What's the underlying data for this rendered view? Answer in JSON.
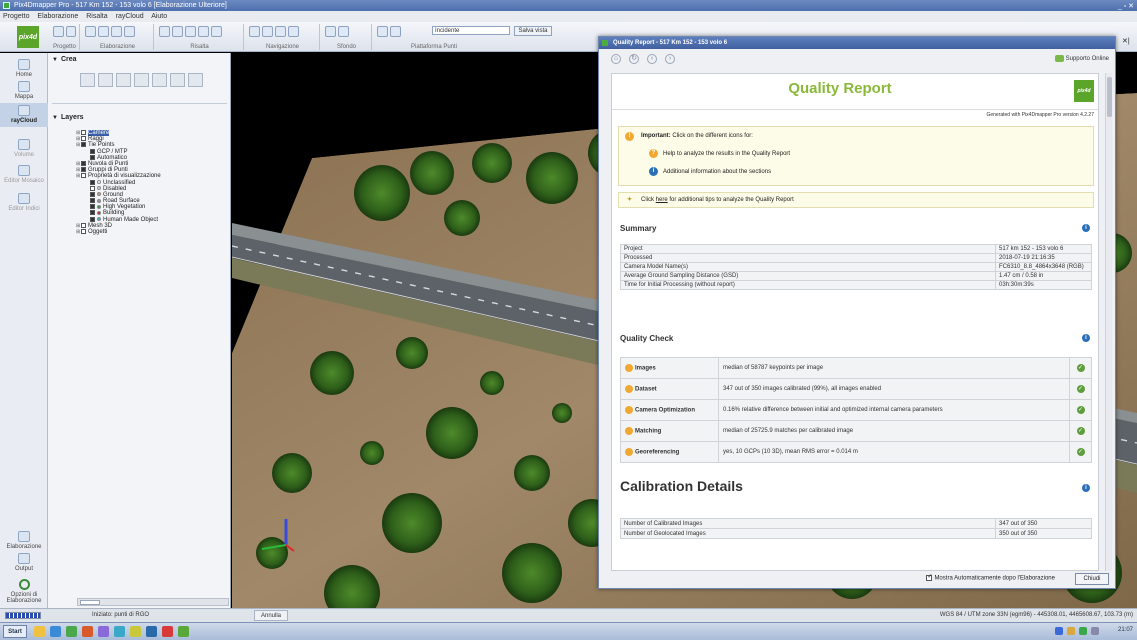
{
  "app": {
    "title": "Pix4Dmapper Pro - 517 Km 152 - 153 volo 6 [Elaborazione Ulteriore]",
    "menu": [
      "Progetto",
      "Elaborazione",
      "Risalta",
      "rayCloud",
      "Aiuto"
    ]
  },
  "ribbon": {
    "logo_text": "pix4d",
    "groups": [
      "Progetto",
      "Elaborazione",
      "Risalta",
      "Navigazione",
      "Sfondo",
      "Piattaforma Punti"
    ],
    "combo_value": "Incidente",
    "button_label": "Salva vista"
  },
  "leftnav": {
    "items": [
      {
        "label": "Home",
        "active": false
      },
      {
        "label": "Mappa",
        "active": false
      },
      {
        "label": "rayCloud",
        "active": true
      },
      {
        "label": "Volume",
        "active": false
      },
      {
        "label": "Editor Mosaico",
        "active": false
      },
      {
        "label": "Editor Indici",
        "active": false
      }
    ],
    "bottom_items": [
      {
        "label": "Elaborazione"
      },
      {
        "label": "Output"
      },
      {
        "label": "Opzioni di Elaborazione"
      }
    ]
  },
  "sidepanel": {
    "crop_title": "Crea",
    "layers_title": "Layers",
    "tree": [
      {
        "label": "Camere",
        "level": 0,
        "checked": false,
        "selected": true,
        "dot": null
      },
      {
        "label": "Raggi",
        "level": 0,
        "checked": false,
        "selected": false,
        "dot": null
      },
      {
        "label": "Tie Points",
        "level": 0,
        "checked": true,
        "selected": false,
        "dot": null
      },
      {
        "label": "GCP / MTP",
        "level": 1,
        "checked": true,
        "selected": false,
        "dot": null
      },
      {
        "label": "Automatico",
        "level": 1,
        "checked": true,
        "selected": false,
        "dot": null
      },
      {
        "label": "Nuvola di Punti",
        "level": 0,
        "checked": true,
        "selected": false,
        "dot": null
      },
      {
        "label": "Gruppi di Punti",
        "level": 0,
        "checked": true,
        "selected": false,
        "dot": null
      },
      {
        "label": "Proprietà di visualizzazione",
        "level": 0,
        "checked": false,
        "selected": false,
        "dot": null
      },
      {
        "label": "Unclassified",
        "level": 1,
        "checked": true,
        "selected": false,
        "dot": "#ffffff"
      },
      {
        "label": "Disabled",
        "level": 1,
        "checked": false,
        "selected": false,
        "dot": "#dddddd"
      },
      {
        "label": "Ground",
        "level": 1,
        "checked": true,
        "selected": false,
        "dot": "#c8a060"
      },
      {
        "label": "Road Surface",
        "level": 1,
        "checked": true,
        "selected": false,
        "dot": "#999999"
      },
      {
        "label": "High Vegetation",
        "level": 1,
        "checked": true,
        "selected": false,
        "dot": "#2e9e2e"
      },
      {
        "label": "Building",
        "level": 1,
        "checked": true,
        "selected": false,
        "dot": "#cc2222"
      },
      {
        "label": "Human Made Object",
        "level": 1,
        "checked": true,
        "selected": false,
        "dot": "#33bbdd"
      },
      {
        "label": "Mesh 3D",
        "level": 0,
        "checked": false,
        "selected": false,
        "dot": null
      },
      {
        "label": "Oggetti",
        "level": 0,
        "checked": false,
        "selected": false,
        "dot": null
      }
    ]
  },
  "report": {
    "window_title": "Quality Report - 517 Km 152 - 153 volo 6",
    "support_label": "Supporto Online",
    "heading": "Quality Report",
    "logo_text": "pix4d",
    "generated": "Generated with Pix4Dmapper Pro version 4.2.27",
    "important_label": "Important:",
    "important_text": "Click on the different icons for:",
    "help_text": "Help to analyze the results in the Quality Report",
    "additional_text": "Additional information about the sections",
    "tips_prefix": "Click ",
    "tips_link": "here",
    "tips_suffix": " for additional tips to analyze the Quality Report",
    "summary_title": "Summary",
    "summary_rows": [
      {
        "label": "Project",
        "value": "517 km 152 - 153 volo 6"
      },
      {
        "label": "Processed",
        "value": "2018-07-19 21:16:35"
      },
      {
        "label": "Camera Model Name(s)",
        "value": "FC6310_8.8_4864x3648 (RGB)"
      },
      {
        "label": "Average Ground Sampling Distance (GSD)",
        "value": "1.47 cm / 0.58 in"
      },
      {
        "label": "Time for Initial Processing (without report)",
        "value": "03h:30m:39s"
      }
    ],
    "quality_title": "Quality Check",
    "quality_rows": [
      {
        "name": "Images",
        "text": "median of 58787 keypoints per image"
      },
      {
        "name": "Dataset",
        "text": "347 out of 350 images calibrated (99%), all images enabled"
      },
      {
        "name": "Camera Optimization",
        "text": "0.16% relative difference between initial and optimized internal camera parameters"
      },
      {
        "name": "Matching",
        "text": "median of 25725.9 matches per calibrated image"
      },
      {
        "name": "Georeferencing",
        "text": "yes, 10 GCPs (10 3D), mean RMS error = 0.014 m"
      }
    ],
    "calibration_title": "Calibration Details",
    "calibration_rows": [
      {
        "label": "Number of Calibrated Images",
        "value": "347 out of 350"
      },
      {
        "label": "Number of Geolocated Images",
        "value": "350 out of 350"
      }
    ],
    "footer_checkbox": "Mostra Automaticamente dopo l'Elaborazione",
    "close_label": "Chiudi"
  },
  "statusbar": {
    "text": "Iniziato: punti di RGO",
    "mode": "Annulla",
    "coords": "WGS 84 / UTM zone 33N (egm96) - 445308.01, 4465608.67, 103.73 (m)"
  },
  "taskbar": {
    "start_label": "Start",
    "clock": "21:07"
  }
}
